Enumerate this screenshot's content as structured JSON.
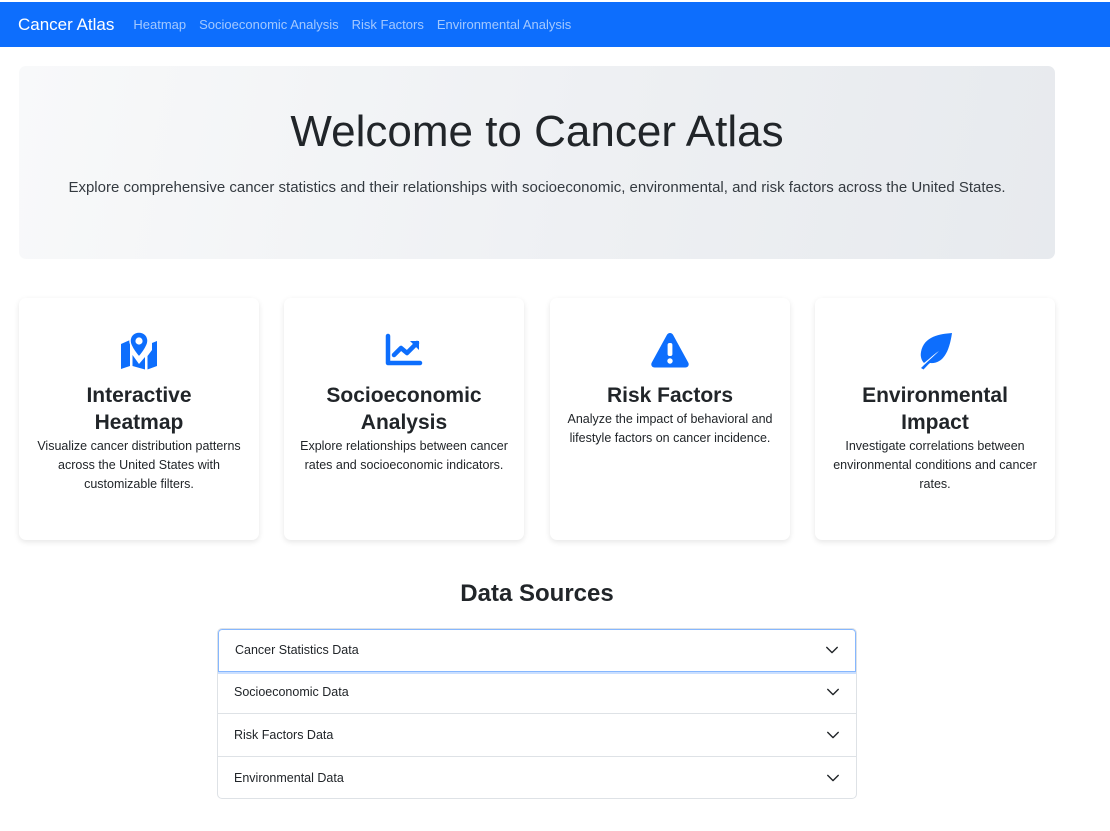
{
  "navbar": {
    "brand": "Cancer Atlas",
    "links": [
      "Heatmap",
      "Socioeconomic Analysis",
      "Risk Factors",
      "Environmental Analysis"
    ]
  },
  "hero": {
    "title": "Welcome to Cancer Atlas",
    "subtitle": "Explore comprehensive cancer statistics and their relationships with socioeconomic, environmental, and risk factors across the United States."
  },
  "features": [
    {
      "icon": "map-location-icon",
      "title_line1": "Interactive",
      "title_line2": "Heatmap",
      "text": "Visualize cancer distribution patterns across the United States with customizable filters."
    },
    {
      "icon": "line-chart-icon",
      "title_line1": "Socioeconomic",
      "title_line2": "Analysis",
      "text": "Explore relationships between cancer rates and socioeconomic indicators."
    },
    {
      "icon": "warning-triangle-icon",
      "title_line1": "Risk Factors",
      "title_line2": "",
      "text": "Analyze the impact of behavioral and lifestyle factors on cancer incidence."
    },
    {
      "icon": "leaf-icon",
      "title_line1": "Environmental",
      "title_line2": "Impact",
      "text": "Investigate correlations between environmental conditions and cancer rates."
    }
  ],
  "data_sources": {
    "title": "Data Sources",
    "items": [
      "Cancer Statistics Data",
      "Socioeconomic Data",
      "Risk Factors Data",
      "Environmental Data"
    ]
  },
  "colors": {
    "primary": "#0d6efd",
    "icon_blue": "#0d6efd"
  }
}
